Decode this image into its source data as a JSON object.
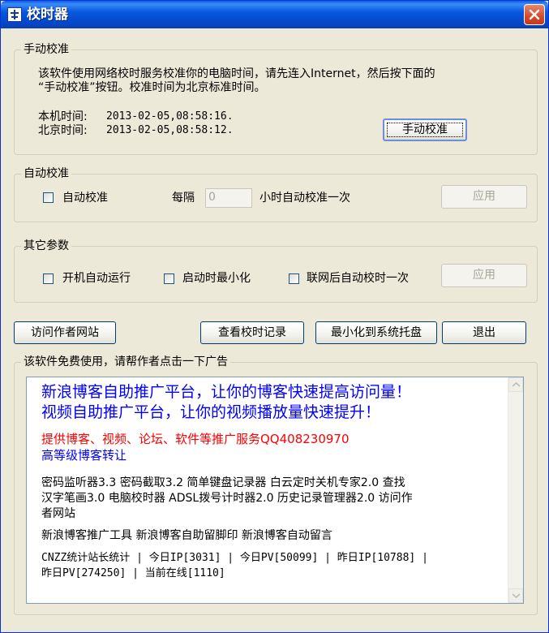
{
  "window": {
    "title": "校时器",
    "icon": "clock-icon",
    "close": "close-icon"
  },
  "manual": {
    "group_title": "手动校准",
    "desc_line1": "该软件使用网络校时服务校准你的电脑时间，请先连入Internet，然后按下面的",
    "desc_line2": "“手动校准”按钮。校准时间为北京标准时间。",
    "local_time_label": "本机时间:",
    "local_time_value": "2013-02-05,08:58:16.",
    "beijing_time_label": "北京时间:",
    "beijing_time_value": "2013-02-05,08:58:12.",
    "button": "手动校准"
  },
  "auto": {
    "group_title": "自动校准",
    "checkbox_label": "自动校准",
    "interval_prefix": "每隔",
    "interval_value": "0",
    "interval_suffix": "小时自动校准一次",
    "apply": "应用"
  },
  "other": {
    "group_title": "其它参数",
    "opt1": "开机自动运行",
    "opt2": "启动时最小化",
    "opt3": "联网后自动校时一次",
    "apply": "应用"
  },
  "actions": {
    "visit_site": "访问作者网站",
    "view_log": "查看校时记录",
    "minimize_tray": "最小化到系统托盘",
    "exit": "退出"
  },
  "ad": {
    "group_title": "该软件免费使用，请帮作者点击一下广告",
    "line1": "新浪博客自助推广平台，让你的博客快速提高访问量！",
    "line2": "视频自助推广平台，让你的视频播放量快速提升！",
    "line3": "提供博客、视频、论坛、软件等推广服务QQ408230970",
    "line4": "高等级博客转让",
    "line5": "密码监听器3.3 密码截取3.2 简单键盘记录器 白云定时关机专家2.0 查找",
    "line6": "汉字笔画3.0 电脑校时器 ADSL拨号计时器2.0 历史记录管理器2.0 访问作",
    "line7": "者网站",
    "line8": "新浪博客推广工具 新浪博客自助留脚印 新浪博客自动留言",
    "line9": "CNZZ统计站长统计 | 今日IP[3031] | 今日PV[50099] | 昨日IP[10788] |",
    "line10": "昨日PV[274250] | 当前在线[1110]"
  },
  "colors": {
    "ad_blue": "#0000FF",
    "ad_red": "#FF0000",
    "titlebar": "#0758E0"
  }
}
